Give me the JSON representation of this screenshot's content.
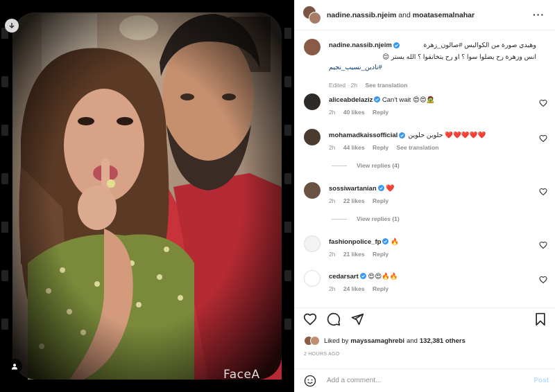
{
  "header": {
    "user1": "nadine.nassib.njeim",
    "and": "and",
    "user2": "moatasemalnahar"
  },
  "caption": {
    "username": "nadine.nassib.njeim",
    "line1": "وهيدي صورة من الكواليس #صالون_زهرة",
    "line2": "انس وزهرة رح يضلوا سوا ؟ او رح يتخانقوا ؟ الله يستر 😌",
    "hashtag": "#نادين_نسيب_نجيم",
    "edited": "Edited · 2h",
    "see_translation": "See translation"
  },
  "comments": [
    {
      "username": "aliceabdelaziz",
      "verified": true,
      "text": "Can't wait 😍😍🧟",
      "time": "2h",
      "likes": "40 likes",
      "reply": "Reply"
    },
    {
      "username": "mohamadkaissofficial",
      "verified": true,
      "text": "حلوين حلوين ❤️❤️❤️❤️❤️",
      "time": "2h",
      "likes": "44 likes",
      "reply": "Reply",
      "see_translation": "See translation",
      "view_replies": "View replies (4)"
    },
    {
      "username": "sossiwartanian",
      "verified": true,
      "text": "❤️",
      "time": "2h",
      "likes": "22 likes",
      "reply": "Reply",
      "view_replies": "View replies (1)"
    },
    {
      "username": "fashionpolice_fp",
      "verified": true,
      "text": "🔥",
      "time": "2h",
      "likes": "21 likes",
      "reply": "Reply"
    },
    {
      "username": "cedarsart",
      "verified": true,
      "text": "😍😍🔥🔥",
      "time": "2h",
      "likes": "24 likes",
      "reply": "Reply"
    }
  ],
  "likes": {
    "prefix": "Liked by",
    "user": "mayssamaghrebi",
    "mid": "and",
    "count": "132,381 others"
  },
  "time_ago": "2 HOURS AGO",
  "add_comment": {
    "placeholder": "Add a comment...",
    "post": "Post"
  },
  "media": {
    "watermark": "FaceA"
  },
  "colors": {
    "verified": "#3897f0",
    "heart_red": "#ed4956",
    "post_disabled": "#b2dffc",
    "muted": "#8e8e8e"
  }
}
